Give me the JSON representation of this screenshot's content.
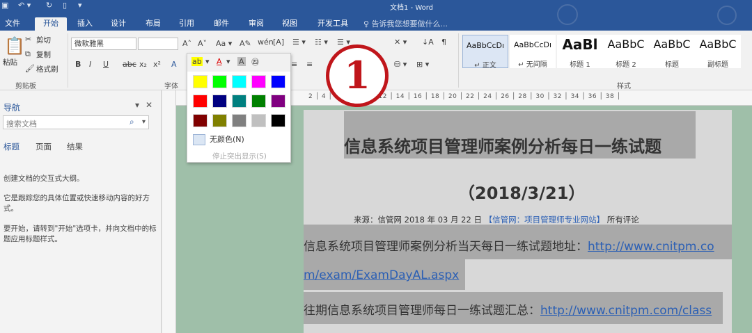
{
  "window": {
    "title": "文档1 - Word"
  },
  "tabs": [
    "文件",
    "开始",
    "插入",
    "设计",
    "布局",
    "引用",
    "邮件",
    "审阅",
    "视图",
    "开发工具"
  ],
  "active_tab": "开始",
  "tell_me": "♀ 告诉我您想要做什么...",
  "clipboard": {
    "cut": "剪切",
    "copy": "复制",
    "paste": "粘贴",
    "format_painter": "格式刷",
    "label": "剪贴板"
  },
  "font": {
    "name": "微软雅黑",
    "label": "字体",
    "buttons": [
      "B",
      "I",
      "U",
      "abc",
      "x₂",
      "x²"
    ]
  },
  "styles": {
    "label": "样式",
    "items": [
      {
        "sample": "AaBbCcDı",
        "name": "↵ 正文"
      },
      {
        "sample": "AaBbCcDı",
        "name": "↵ 无间隔"
      },
      {
        "sample": "AaBl",
        "name": "标题 1"
      },
      {
        "sample": "AaBbC",
        "name": "标题 2"
      },
      {
        "sample": "AaBbC",
        "name": "标题"
      },
      {
        "sample": "AaBbC",
        "name": "副标题"
      }
    ]
  },
  "highlight_popup": {
    "colors": [
      "#ffff00",
      "#00ff00",
      "#00ffff",
      "#ff00ff",
      "#0000ff",
      "#ff0000",
      "#000080",
      "#008080",
      "#008000",
      "#800080",
      "#800000",
      "#808000",
      "#808080",
      "#c0c0c0",
      "#000000"
    ],
    "no_color": "无颜色(N)",
    "stop": "停止突出显示(S)"
  },
  "step_badge": "1",
  "nav": {
    "title": "导航",
    "search_placeholder": "搜索文档",
    "tabs": [
      "标题",
      "页面",
      "结果"
    ],
    "hint1": "创建文档的交互式大纲。",
    "hint2": "它是跟踪您的具体位置或快速移动内容的好方式。",
    "hint3": "要开始，请转到\"开始\"选项卡，并向文档中的标题应用标题样式。"
  },
  "ruler_numbers": "2 │ 4 │ 6 │ 8 │ 10 │ 12 │ 14 │ 16 │ 18 │ 20 │ 22 │ 24 │ 26 │ 28 │ 30 │ 32 │ 34 │ 36 │ 38 │",
  "document": {
    "title": "信息系统项目管理师案例分析每日一练试题",
    "date": "（2018/3/21）",
    "source_prefix": "来源：信管网",
    "source_date": "2018 年 03 月 22 日",
    "source_site": "【信管网：项目管理师专业网站】",
    "source_comments": "所有评论",
    "line1_text": "信息系统项目管理师案例分析当天每日一练试题地址：",
    "line1_link": "http://www.cnitpm.co",
    "line2_link": "m/exam/ExamDayAL.aspx",
    "line3_text": "往期信息系统项目管理师每日一练试题汇总：",
    "line3_link": "http://www.cnitpm.com/class"
  }
}
